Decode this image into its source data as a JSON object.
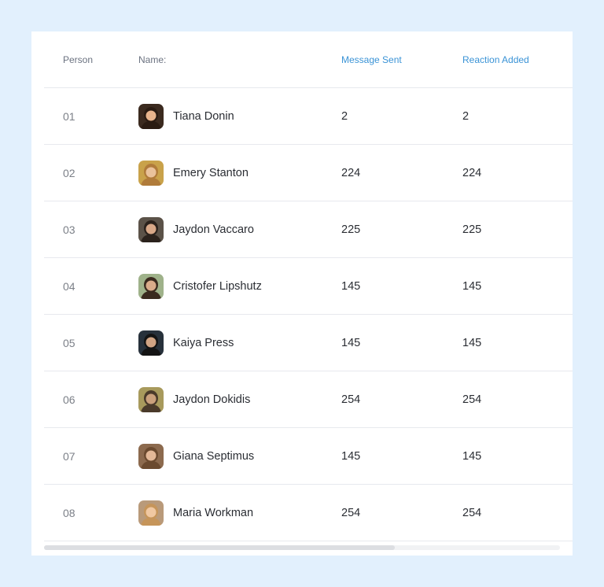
{
  "table": {
    "headers": {
      "person": "Person",
      "name": "Name:",
      "messages": "Message Sent",
      "reactions": "Reaction Added"
    },
    "accent_color": "#3a93d6",
    "rows": [
      {
        "index": "01",
        "name": "Tiana Donin",
        "messages": "2",
        "reactions": "2",
        "avatar_bg": "#3b2a1f",
        "avatar_face": "#e8b48c",
        "avatar_hair": "#2a1b12"
      },
      {
        "index": "02",
        "name": "Emery Stanton",
        "messages": "224",
        "reactions": "224",
        "avatar_bg": "#c9a24a",
        "avatar_face": "#eac29b",
        "avatar_hair": "#b07b3a"
      },
      {
        "index": "03",
        "name": "Jaydon Vaccaro",
        "messages": "225",
        "reactions": "225",
        "avatar_bg": "#5b5248",
        "avatar_face": "#d8a888",
        "avatar_hair": "#2b221c"
      },
      {
        "index": "04",
        "name": "Cristofer Lipshutz",
        "messages": "145",
        "reactions": "145",
        "avatar_bg": "#9fb28a",
        "avatar_face": "#d9ab8a",
        "avatar_hair": "#3a2a1f"
      },
      {
        "index": "05",
        "name": "Kaiya Press",
        "messages": "145",
        "reactions": "145",
        "avatar_bg": "#27313b",
        "avatar_face": "#d1a484",
        "avatar_hair": "#141414"
      },
      {
        "index": "06",
        "name": "Jaydon Dokidis",
        "messages": "254",
        "reactions": "254",
        "avatar_bg": "#a89a5c",
        "avatar_face": "#caa07c",
        "avatar_hair": "#4a3a2a"
      },
      {
        "index": "07",
        "name": "Giana Septimus",
        "messages": "145",
        "reactions": "145",
        "avatar_bg": "#8c6a4e",
        "avatar_face": "#e3b897",
        "avatar_hair": "#6b4a2f"
      },
      {
        "index": "08",
        "name": "Maria Workman",
        "messages": "254",
        "reactions": "254",
        "avatar_bg": "#b99a7a",
        "avatar_face": "#f0c8a2",
        "avatar_hair": "#c6955a"
      }
    ]
  },
  "scrollbar": {
    "visible_fraction": 0.68
  }
}
